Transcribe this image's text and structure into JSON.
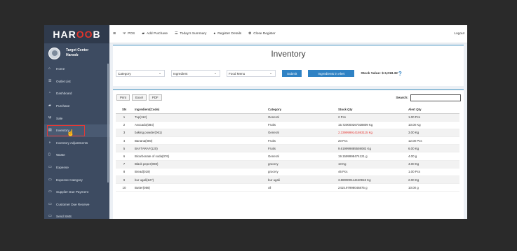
{
  "logo": {
    "part1": "HAR",
    "part2": "OO",
    "part3": "B"
  },
  "user": {
    "line1": "Target Center",
    "line2": "Haroob"
  },
  "sidebar": {
    "items": [
      {
        "label": "Home",
        "icon": "home-icon",
        "glyph": "⌂"
      },
      {
        "label": "Outlet List",
        "icon": "list-icon",
        "glyph": "☰"
      },
      {
        "label": "Dashboard",
        "icon": "dashboard-icon",
        "glyph": "◔"
      },
      {
        "label": "Purchase",
        "icon": "truck-icon",
        "glyph": "▰"
      },
      {
        "label": "Sale",
        "icon": "cutlery-icon",
        "glyph": "Ψ"
      },
      {
        "label": "Inventory",
        "icon": "inventory-icon",
        "glyph": "▤"
      },
      {
        "label": "Inventory Adjustments",
        "icon": "adjust-icon",
        "glyph": "◑"
      },
      {
        "label": "Waste",
        "icon": "trash-icon",
        "glyph": "▯"
      },
      {
        "label": "Expense",
        "icon": "money-icon",
        "glyph": "▭"
      },
      {
        "label": "Expense Category",
        "icon": "money-icon",
        "glyph": "▭"
      },
      {
        "label": "Supplier Due Payment",
        "icon": "money-icon",
        "glyph": "▭"
      },
      {
        "label": "Customer Due Receive",
        "icon": "money-icon",
        "glyph": "▭"
      },
      {
        "label": "Send SMS",
        "icon": "sms-icon",
        "glyph": "▭"
      }
    ]
  },
  "topbar": {
    "menu_glyph": "≡",
    "items": [
      {
        "label": "POS",
        "glyph": "Ψ"
      },
      {
        "label": "Add Purchase",
        "glyph": "▰"
      },
      {
        "label": "Today's Summary",
        "glyph": "☰"
      },
      {
        "label": "Register Details",
        "glyph": "●"
      },
      {
        "label": "Close Register",
        "glyph": "✿"
      }
    ],
    "logout": "Logout"
  },
  "page": {
    "title": "Inventory",
    "filters": {
      "category": "Category",
      "ingredient": "Ingredient",
      "food_menu": "Food Menu",
      "chevron": "⌄"
    },
    "submit": "Submit",
    "alert_button": "Ingredients in Alert",
    "stock_value": "Stock Value: $ 6,018.32",
    "help_glyph": "?"
  },
  "table": {
    "tools": {
      "print": "Print",
      "excel": "Excel",
      "pdf": "PDF"
    },
    "search_label": "Search:",
    "headers": {
      "sn": "SN",
      "ingredient": "Ingredient(Code)",
      "category": "Category",
      "stock": "Stock Qty",
      "alert": "Alert Qty"
    },
    "rows": [
      {
        "sn": "1",
        "ingredient": "Tup(112)",
        "category": "General",
        "stock": "2 Pcs",
        "alert": "1.00 Pcs"
      },
      {
        "sn": "2",
        "ingredient": "Avocado(084)",
        "category": "Fruits",
        "stock": "15.720000267028809 Kg",
        "alert": "10.00 Kg"
      },
      {
        "sn": "3",
        "ingredient": "baking powder(061)",
        "category": "General",
        "stock": "2.3399999141693115 Kg",
        "alert": "3.00 Kg"
      },
      {
        "sn": "4",
        "ingredient": "Banana(080)",
        "category": "Fruits",
        "stock": "20 Pcs",
        "alert": "12.00 Pcs"
      },
      {
        "sn": "5",
        "ingredient": "BAYTARAF(120)",
        "category": "Fruits",
        "stock": "9.619999885559082 Kg",
        "alert": "6.00 Kg"
      },
      {
        "sn": "6",
        "ingredient": "Bicarbonate of soda(076)",
        "category": "General",
        "stock": "19.1599998474121 g",
        "alert": "4.00 g"
      },
      {
        "sn": "7",
        "ingredient": "Black peper(069)",
        "category": "grocery",
        "stock": "10 Kg",
        "alert": "4.00 Kg"
      },
      {
        "sn": "8",
        "ingredient": "Bread(019)",
        "category": "grocery",
        "stock": "46 Pcs",
        "alert": "1.00 Pcs"
      },
      {
        "sn": "9",
        "ingredient": "bur ugali(127)",
        "category": "bur ugali",
        "stock": "3.880000114440918 Kg",
        "alert": "2.00 Kg"
      },
      {
        "sn": "10",
        "ingredient": "Butter(056)",
        "category": "oil",
        "stock": "2415.97998046875 g",
        "alert": "10.00 g"
      }
    ]
  },
  "colors": {
    "accent": "#3c8dbc",
    "sidebar": "#3d4b61",
    "alert_text": "#e53935",
    "logo_red": "#e2342b"
  }
}
